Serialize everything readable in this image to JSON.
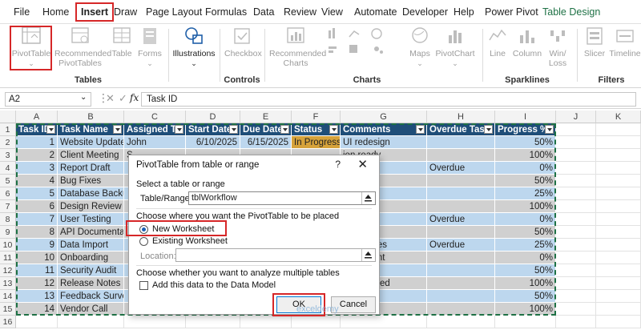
{
  "menu": {
    "tabs": [
      "File",
      "Home",
      "Insert",
      "Draw",
      "Page Layout",
      "Formulas",
      "Data",
      "Review",
      "View",
      "Automate",
      "Developer",
      "Help",
      "Power Pivot",
      "Table Design"
    ],
    "active": "Insert"
  },
  "ribbon": {
    "groups": {
      "tables": "Tables",
      "illustrations": "Illustrations",
      "controls": "Controls",
      "charts": "Charts",
      "sparklines": "Sparklines",
      "filters": "Filters"
    },
    "buttons": {
      "pivottable": "PivotTable",
      "rec_pivot_1": "Recommended",
      "rec_pivot_2": "PivotTables",
      "table": "Table",
      "forms": "Forms",
      "checkbox": "Checkbox",
      "rec_charts_1": "Recommended",
      "rec_charts_2": "Charts",
      "maps": "Maps",
      "pivotchart": "PivotChart",
      "line": "Line",
      "column": "Column",
      "winloss_1": "Win/",
      "winloss_2": "Loss",
      "slicer": "Slicer",
      "timeline": "Timeline"
    }
  },
  "formula_bar": {
    "name_box": "A2",
    "fx": "fx",
    "content": "Task ID"
  },
  "columns": [
    "A",
    "B",
    "C",
    "D",
    "E",
    "F",
    "G",
    "H",
    "I",
    "J",
    "K"
  ],
  "rows": [
    "1",
    "2",
    "3",
    "4",
    "5",
    "6",
    "7",
    "8",
    "9",
    "10",
    "11",
    "12",
    "13",
    "14",
    "15",
    "16"
  ],
  "table": {
    "headers": [
      "Task ID",
      "Task Name",
      "Assigned To",
      "Start Date",
      "Due Date",
      "Status",
      "Comments",
      "Overdue Task",
      "Progress %"
    ],
    "rows": [
      {
        "id": "1",
        "name": "Website Update",
        "assigned": "John",
        "start": "6/10/2025",
        "due": "6/15/2025",
        "status": "In Progress",
        "comments": "UI redesign",
        "overdue": "",
        "progress": "50%"
      },
      {
        "id": "2",
        "name": "Client Meeting",
        "assigned": "S",
        "start": "",
        "due": "",
        "status": "",
        "comments": "ion ready",
        "overdue": "",
        "progress": "100%"
      },
      {
        "id": "3",
        "name": "Report Draft",
        "assigned": "",
        "start": "",
        "due": "",
        "status": "",
        "comments": "ine",
        "overdue": "Overdue",
        "progress": "0%"
      },
      {
        "id": "4",
        "name": "Bug Fixes",
        "assigned": "",
        "start": "",
        "due": "",
        "status": "",
        "comments": "rity bugs",
        "overdue": "",
        "progress": "50%"
      },
      {
        "id": "5",
        "name": "Database Backu",
        "assigned": "",
        "start": "",
        "due": "",
        "status": "",
        "comments": "access",
        "overdue": "",
        "progress": "25%"
      },
      {
        "id": "6",
        "name": "Design Review",
        "assigned": "",
        "start": "",
        "due": "",
        "status": "",
        "comments": "",
        "overdue": "",
        "progress": "100%"
      },
      {
        "id": "7",
        "name": "User Testing",
        "assigned": "",
        "start": "",
        "due": "",
        "status": "",
        "comments": "pending",
        "overdue": "Overdue",
        "progress": "0%"
      },
      {
        "id": "8",
        "name": "API Documentation",
        "assigned": "",
        "start": "",
        "due": "",
        "status": "",
        "comments": "",
        "overdue": "",
        "progress": "50%"
      },
      {
        "id": "9",
        "name": "Data Import",
        "assigned": "",
        "start": "",
        "due": "",
        "status": "",
        "comments": "mat issues",
        "overdue": "Overdue",
        "progress": "25%"
      },
      {
        "id": "10",
        "name": "Onboarding",
        "assigned": "",
        "start": "",
        "due": "",
        "status": "",
        "comments": "email sent",
        "overdue": "",
        "progress": "0%"
      },
      {
        "id": "11",
        "name": "Security Audit",
        "assigned": "",
        "start": "",
        "due": "",
        "status": "",
        "comments": "oing",
        "overdue": "",
        "progress": "50%"
      },
      {
        "id": "12",
        "name": "Release Notes",
        "assigned": "",
        "start": "",
        "due": "",
        "status": "",
        "comments": "ft published",
        "overdue": "",
        "progress": "100%"
      },
      {
        "id": "13",
        "name": "Feedback Survey",
        "assigned": "",
        "start": "",
        "due": "",
        "status": "",
        "comments": "",
        "overdue": "",
        "progress": "50%"
      },
      {
        "id": "14",
        "name": "Vendor Call",
        "assigned": "",
        "start": "",
        "due": "",
        "status": "",
        "comments": "",
        "overdue": "",
        "progress": "100%"
      }
    ]
  },
  "dialog": {
    "title": "PivotTable from table or range",
    "help": "?",
    "close": "✕",
    "select_section": "Select a table or range",
    "table_range_label": "Table/Range:",
    "table_range_value": "tblWorkflow",
    "place_section": "Choose where you want the PivotTable to be placed",
    "new_worksheet": "New Worksheet",
    "existing_worksheet": "Existing Worksheet",
    "location_label": "Location:",
    "location_value": "",
    "multi_section": "Choose whether you want to analyze multiple tables",
    "data_model_label": "Add this data to the Data Model",
    "ok": "OK",
    "cancel": "Cancel",
    "selected_placement": "New Worksheet"
  },
  "watermark": "exceldemy",
  "colors": {
    "header": "#1f4e79",
    "band1": "#bdd7ee",
    "band2": "#d0d0d0",
    "in_progress": "#d6a23a",
    "highlight": "#d62728",
    "accent": "#1e7145"
  }
}
